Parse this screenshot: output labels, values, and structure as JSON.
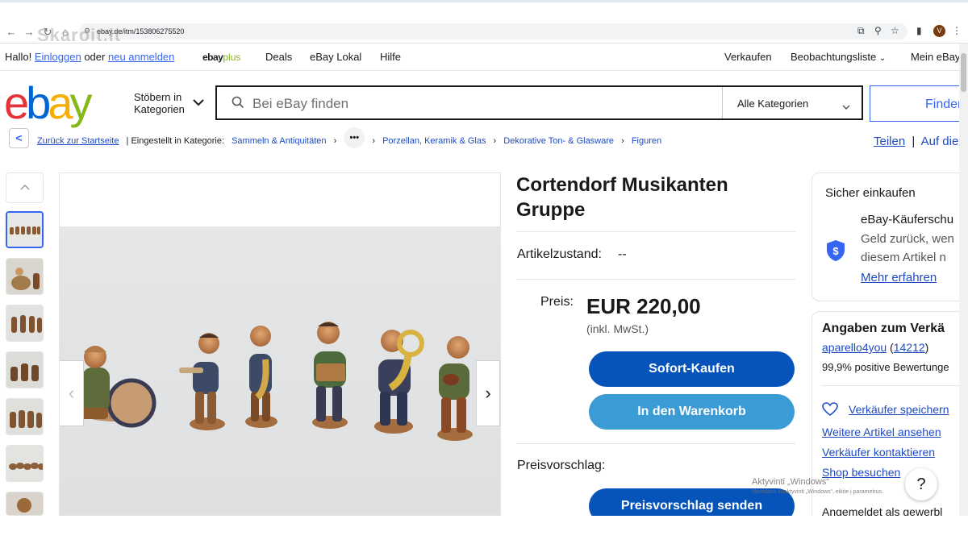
{
  "browser": {
    "url": "ebay.de/itm/153806275520",
    "watermark": "Skaroit.lt"
  },
  "header": {
    "greeting": "Hallo!",
    "login": "Einloggen",
    "or": "oder",
    "register": "neu anmelden",
    "ebayplus_ebay": "ebay",
    "ebayplus_plus": "plus",
    "deals": "Deals",
    "local": "eBay Lokal",
    "help": "Hilfe",
    "sell": "Verkaufen",
    "watchlist": "Beobachtungsliste",
    "myebay": "Mein eBay"
  },
  "logo": {
    "letters": [
      "e",
      "b",
      "a",
      "y"
    ],
    "colors": [
      "#e53238",
      "#0064d2",
      "#f5af02",
      "#86b817"
    ]
  },
  "search": {
    "browse_line1": "Stöbern in",
    "browse_line2": "Kategorien",
    "placeholder": "Bei eBay finden",
    "category": "Alle Kategorien",
    "button": "Finden"
  },
  "breadcrumb": {
    "back": "Zurück zur Startseite",
    "listed_in": "| Eingestellt in Kategorie:",
    "items": [
      "Sammeln & Antiquitäten",
      "Porzellan, Keramik & Glas",
      "Dekorative Ton- & Glasware",
      "Figuren"
    ],
    "share": "Teilen",
    "sep": "|",
    "watch": "Auf die"
  },
  "item": {
    "title": "Cortendorf Musikanten Gruppe",
    "condition_label": "Artikelzustand:",
    "condition_value": "--",
    "price_label": "Preis:",
    "price": "EUR 220,00",
    "tax_note": "(inkl. MwSt.)",
    "buy_now": "Sofort-Kaufen",
    "add_to_cart": "In den Warenkorb",
    "offer_label": "Preisvorschlag:",
    "offer_button": "Preisvorschlag senden"
  },
  "safe": {
    "heading": "Sicher einkaufen",
    "line1": "eBay-Käuferschu",
    "line2": "Geld zurück, wen",
    "line3": "diesem Artikel n",
    "more": "Mehr erfahren"
  },
  "seller": {
    "heading": "Angaben zum Verkä",
    "name": "aparello4you",
    "score": "14212",
    "feedback": "99,9% positive Bewertunge",
    "save": "Verkäufer speichern",
    "more_items": "Weitere Artikel ansehen",
    "contact": "Verkäufer kontaktieren",
    "shop": "Shop besuchen",
    "logged_in": "Angemeldet als gewerbl"
  },
  "windows": {
    "line1": "Aktyvinti „Windows“",
    "line2": "Norėdami suaktyvinti „Windows“, eikite į parametrus."
  },
  "help_label": "?",
  "colors": {
    "primary": "#0654ba",
    "secondary_button": "#3a9bd5",
    "link": "#1e4bc3"
  }
}
